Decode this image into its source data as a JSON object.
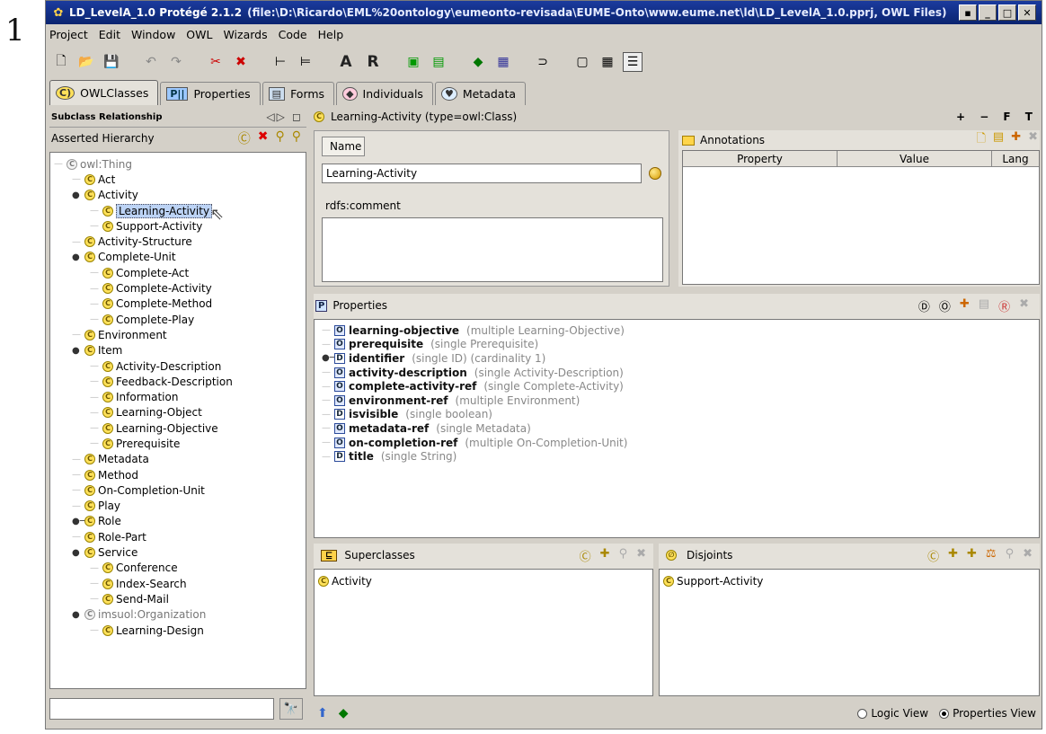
{
  "page_mark": "1",
  "window": {
    "title": "LD_LevelA_1.0 Protégé 2.1.2",
    "title_path": "(file:\\D:\\Ricardo\\EML%20ontology\\eumeonto-revisada\\EUME-Onto\\www.eume.net\\ld\\LD_LevelA_1.0.pprj, OWL Files)"
  },
  "menu": [
    "Project",
    "Edit",
    "Window",
    "OWL",
    "Wizards",
    "Code",
    "Help"
  ],
  "toolbar": {
    "icons": [
      "new-file",
      "open-file",
      "save",
      "undo",
      "redo",
      "cut",
      "delete",
      "add-class",
      "add-subclass",
      "A",
      "R",
      "owl-icon-1",
      "owl-icon-2",
      "individual",
      "datatype",
      "logic",
      "form",
      "grid",
      "tree"
    ],
    "text_a": "A",
    "text_r": "R"
  },
  "tabs": [
    {
      "label": "OWLClasses",
      "icon": "C",
      "active": true
    },
    {
      "label": "Properties",
      "icon": "P",
      "active": false
    },
    {
      "label": "Forms",
      "icon": "",
      "active": false
    },
    {
      "label": "Individuals",
      "icon": "",
      "active": false
    },
    {
      "label": "Metadata",
      "icon": "",
      "active": false
    }
  ],
  "left": {
    "header": "Subclass Relationship",
    "subheader": "Asserted Hierarchy",
    "tree": [
      {
        "label": "owl:Thing",
        "depth": 0,
        "gray": true,
        "twist": ""
      },
      {
        "label": "Act",
        "depth": 1,
        "twist": ""
      },
      {
        "label": "Activity",
        "depth": 1,
        "twist": "open"
      },
      {
        "label": "Learning-Activity",
        "depth": 2,
        "twist": "",
        "selected": true
      },
      {
        "label": "Support-Activity",
        "depth": 2,
        "twist": ""
      },
      {
        "label": "Activity-Structure",
        "depth": 1,
        "twist": ""
      },
      {
        "label": "Complete-Unit",
        "depth": 1,
        "twist": "open"
      },
      {
        "label": "Complete-Act",
        "depth": 2,
        "twist": ""
      },
      {
        "label": "Complete-Activity",
        "depth": 2,
        "twist": ""
      },
      {
        "label": "Complete-Method",
        "depth": 2,
        "twist": ""
      },
      {
        "label": "Complete-Play",
        "depth": 2,
        "twist": ""
      },
      {
        "label": "Environment",
        "depth": 1,
        "twist": ""
      },
      {
        "label": "Item",
        "depth": 1,
        "twist": "open"
      },
      {
        "label": "Activity-Description",
        "depth": 2,
        "twist": ""
      },
      {
        "label": "Feedback-Description",
        "depth": 2,
        "twist": ""
      },
      {
        "label": "Information",
        "depth": 2,
        "twist": ""
      },
      {
        "label": "Learning-Object",
        "depth": 2,
        "twist": ""
      },
      {
        "label": "Learning-Objective",
        "depth": 2,
        "twist": ""
      },
      {
        "label": "Prerequisite",
        "depth": 2,
        "twist": ""
      },
      {
        "label": "Metadata",
        "depth": 1,
        "twist": ""
      },
      {
        "label": "Method",
        "depth": 1,
        "twist": ""
      },
      {
        "label": "On-Completion-Unit",
        "depth": 1,
        "twist": ""
      },
      {
        "label": "Play",
        "depth": 1,
        "twist": ""
      },
      {
        "label": "Role",
        "depth": 1,
        "twist": "closed"
      },
      {
        "label": "Role-Part",
        "depth": 1,
        "twist": ""
      },
      {
        "label": "Service",
        "depth": 1,
        "twist": "open"
      },
      {
        "label": "Conference",
        "depth": 2,
        "twist": ""
      },
      {
        "label": "Index-Search",
        "depth": 2,
        "twist": ""
      },
      {
        "label": "Send-Mail",
        "depth": 2,
        "twist": ""
      },
      {
        "label": "imsuol:Organization",
        "depth": 1,
        "twist": "open",
        "gray": true
      },
      {
        "label": "Learning-Design",
        "depth": 2,
        "twist": ""
      }
    ]
  },
  "right": {
    "header": "Learning-Activity   (type=owl:Class)",
    "header_ctrls": "+ − F T",
    "name_tab": "Name",
    "name_value": "Learning-Activity",
    "rdfs_label": "rdfs:comment",
    "annotations": {
      "title": "Annotations",
      "columns": [
        "Property",
        "Value",
        "Lang"
      ]
    },
    "properties": {
      "title": "Properties",
      "badge": "P",
      "rows": [
        {
          "type": "O",
          "name": "learning-objective",
          "desc": "(multiple Learning-Objective)",
          "twist": ""
        },
        {
          "type": "O",
          "name": "prerequisite",
          "desc": "(single Prerequisite)",
          "twist": ""
        },
        {
          "type": "D",
          "name": "identifier",
          "desc": "(single ID)    (cardinality 1)",
          "twist": "closed"
        },
        {
          "type": "O",
          "name": "activity-description",
          "desc": "(single Activity-Description)",
          "twist": ""
        },
        {
          "type": "O",
          "name": "complete-activity-ref",
          "desc": "(single Complete-Activity)",
          "twist": ""
        },
        {
          "type": "O",
          "name": "environment-ref",
          "desc": "(multiple Environment)",
          "twist": ""
        },
        {
          "type": "D",
          "name": "isvisible",
          "desc": "(single boolean)",
          "twist": ""
        },
        {
          "type": "O",
          "name": "metadata-ref",
          "desc": "(single Metadata)",
          "twist": ""
        },
        {
          "type": "O",
          "name": "on-completion-ref",
          "desc": "(multiple On-Completion-Unit)",
          "twist": ""
        },
        {
          "type": "D",
          "name": "title",
          "desc": "(single String)",
          "twist": ""
        }
      ]
    },
    "superclasses": {
      "title": "Superclasses",
      "badge": "⊑",
      "items": [
        "Activity"
      ]
    },
    "disjoints": {
      "title": "Disjoints",
      "items": [
        "Support-Activity"
      ]
    },
    "views": {
      "logic": "Logic View",
      "properties": "Properties View",
      "selected": "properties"
    }
  }
}
